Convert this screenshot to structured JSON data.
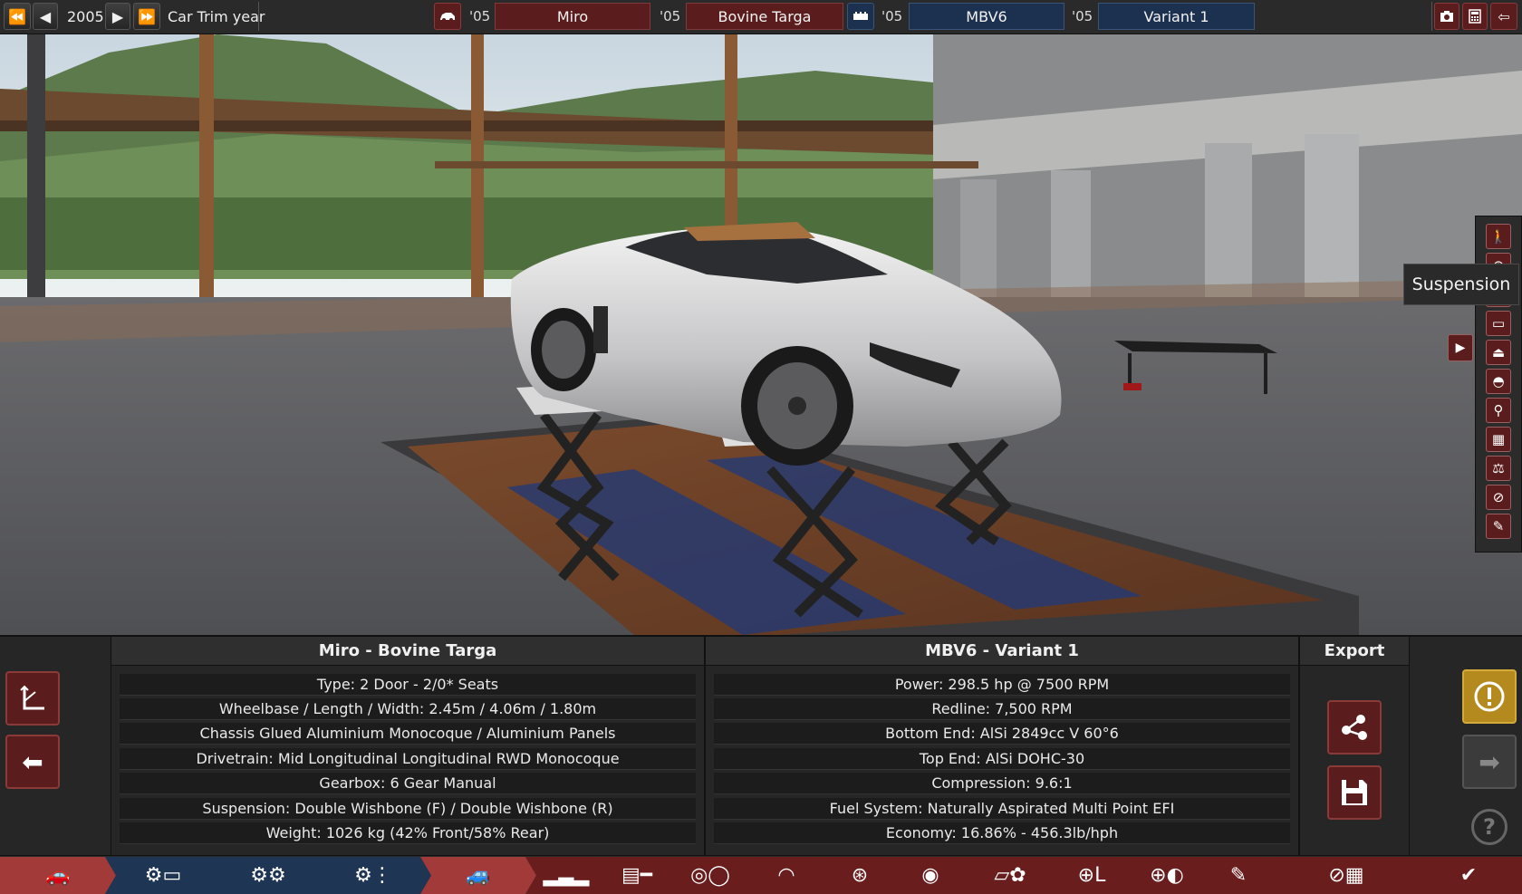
{
  "topbar": {
    "year_label": "2005",
    "year_caption": "Car Trim year",
    "model_year": "'05",
    "model_name": "Miro",
    "trim_year": "'05",
    "trim_name": "Bovine Targa",
    "engine_year": "'05",
    "engine_name": "MBV6",
    "variant_year": "'05",
    "variant_name": "Variant 1"
  },
  "icons": {
    "first": "⏮",
    "prev": "◀",
    "next": "▶",
    "last": "⏭",
    "car": "car-icon",
    "engine": "engine-icon",
    "camera": "camera-icon",
    "calculator": "calculator-icon",
    "back": "back-arrow-icon"
  },
  "viewport": {
    "tooltip": "Suspension",
    "right_tools": [
      "walk-icon",
      "wheel-icon",
      "person-icon",
      "body-icon",
      "car-side-icon",
      "car-body-icon",
      "seat-icon",
      "grille-icon",
      "suspension-icon",
      "brake-icon",
      "edit-icon"
    ]
  },
  "info": {
    "car_title": "Miro - Bovine Targa",
    "car_rows": [
      "Type: 2 Door - 2/0* Seats",
      "Wheelbase / Length / Width: 2.45m / 4.06m / 1.80m",
      "Chassis Glued Aluminium Monocoque / Aluminium Panels",
      "Drivetrain: Mid Longitudinal Longitudinal RWD Monocoque",
      "Gearbox: 6 Gear Manual",
      "Suspension: Double Wishbone (F) / Double Wishbone (R)",
      "Weight: 1026 kg (42% Front/58% Rear)"
    ],
    "engine_title": "MBV6 - Variant 1",
    "engine_rows": [
      "Power: 298.5 hp @ 7500 RPM",
      "Redline:  7,500 RPM",
      "Bottom End: AlSi 2849cc V 60°6",
      "Top End: AlSi DOHC-30",
      "Compression: 9.6:1",
      "Fuel System: Naturally Aspirated Multi Point EFI",
      "Economy: 16.86% - 456.3lb/hph"
    ],
    "export_title": "Export"
  },
  "colors": {
    "red_btn": "#5a1c1c",
    "blue_btn": "#1c3050",
    "gold_btn": "#b48a1f",
    "active_tab": "#a33a3a"
  }
}
